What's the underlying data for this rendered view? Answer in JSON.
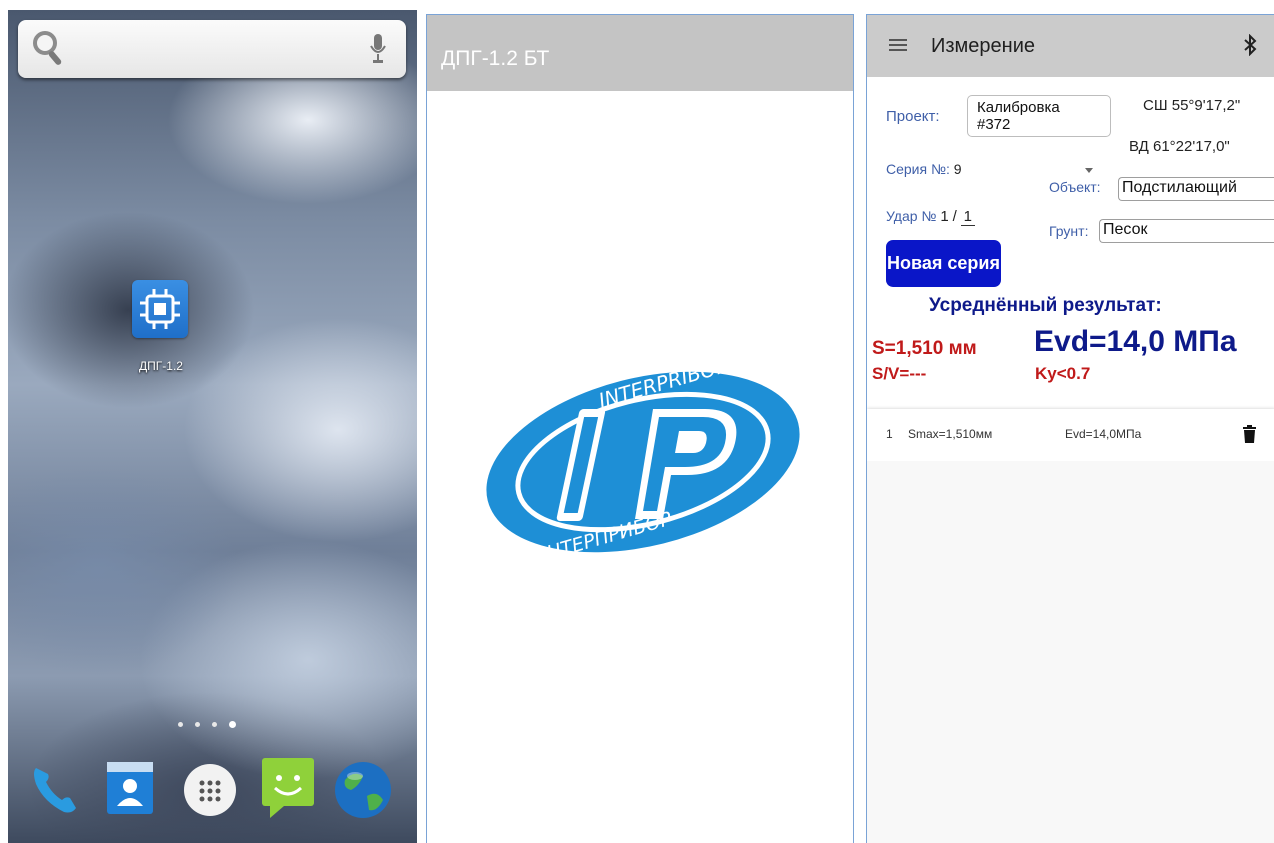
{
  "home_screen": {
    "app_icon_label": "ДПГ-1.2",
    "app_icon_name": "chip-icon",
    "dock_icons": [
      "phone-icon",
      "contacts-icon",
      "app-drawer-icon",
      "messages-icon",
      "browser-globe-icon"
    ],
    "page_indicator_count": 4
  },
  "splash": {
    "title": "ДПГ-1.2 БТ",
    "logo": {
      "top_text": "INTERPRIBOR",
      "bottom_text": "ИНТЕРПРИБОР",
      "monogram": "IP",
      "color": "#1e8fd6"
    }
  },
  "measure": {
    "title": "Измерение",
    "project_label": "Проект:",
    "project_line1": "Калибровка",
    "project_line2": "#372",
    "lat": "СШ 55°9'17,2\"",
    "lon": "ВД 61°22'17,0\"",
    "series_label": "Серия №:",
    "series_value": "9",
    "object_label": "Объект:",
    "object_value": "Подстилающий",
    "hit_label": "Удар №",
    "hit_value": "1",
    "hit_sep": "/",
    "hit_total": "1",
    "soil_label": "Грунт:",
    "soil_value": "Песок",
    "new_series_button": "Новая серия",
    "avg_heading": "Усреднённый результат:",
    "s_value": "S=1,510 мм",
    "evd_value": "Evd=14,0 МПа",
    "sv_value": "S/V=---",
    "ky_value": "Ky<0.7",
    "results": [
      {
        "index": "1",
        "smax": "Smax=1,510мм",
        "evd": "Evd=14,0МПа"
      }
    ],
    "colors": {
      "red": "#c01a1a",
      "dark_blue": "#0e1a8a",
      "button": "#0a16c8",
      "label_blue": "#3f5fa8"
    }
  }
}
